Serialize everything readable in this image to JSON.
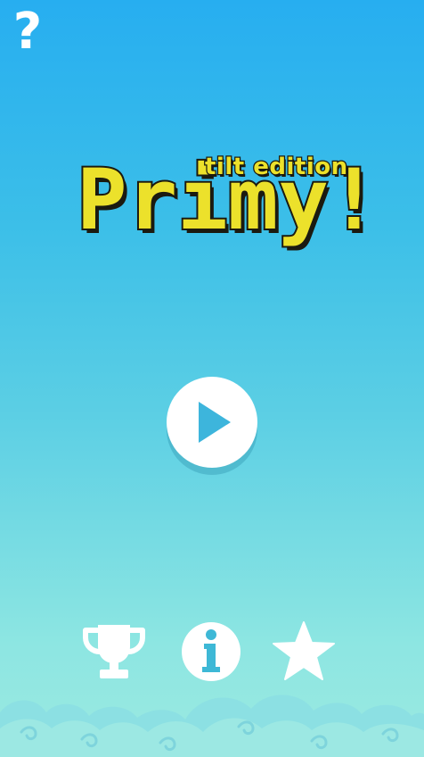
{
  "help": {
    "icon": "question-mark-icon",
    "label": "?"
  },
  "logo": {
    "subtitle": "tilt edition",
    "title": "Primy!"
  },
  "play": {
    "icon": "play-icon"
  },
  "bottom": {
    "items": [
      {
        "icon": "trophy-icon"
      },
      {
        "icon": "info-icon",
        "label": "i"
      },
      {
        "icon": "star-icon"
      }
    ]
  },
  "colors": {
    "sky_top": "#27aef0",
    "sky_bottom": "#9be9e0",
    "logo_fill": "#ece12b",
    "logo_outline": "#1b1a10",
    "play_triangle": "#3db5dc",
    "icon_white": "#ffffff"
  }
}
